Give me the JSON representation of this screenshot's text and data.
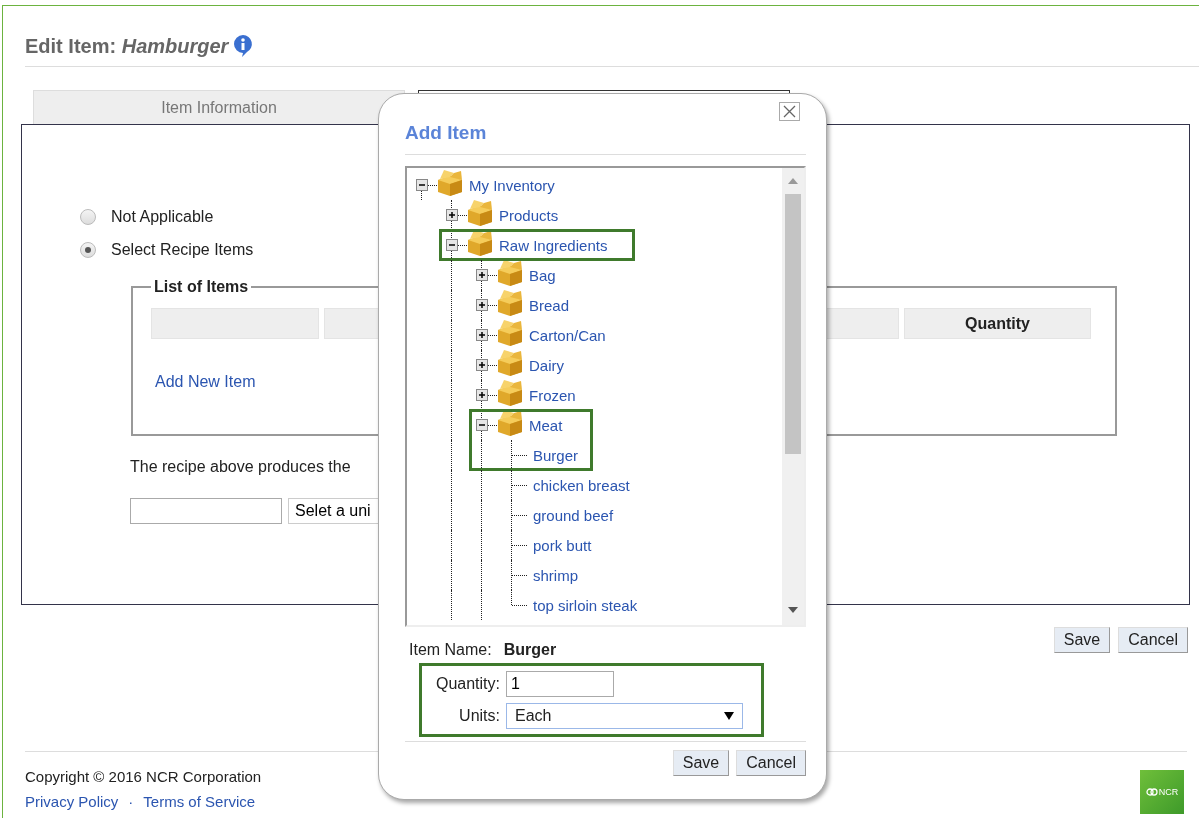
{
  "page": {
    "title_prefix": "Edit Item:",
    "title_item": "Hamburger"
  },
  "tabs": [
    {
      "label": "Item Information",
      "selected": false
    },
    {
      "selected": true
    }
  ],
  "recipe_options": [
    {
      "label": "Not Applicable",
      "selected": false
    },
    {
      "label": "Select Recipe Items",
      "selected": true
    }
  ],
  "list_of_items": {
    "legend": "List of Items",
    "columns": [
      "Quantity"
    ],
    "add_link": "Add New Item"
  },
  "yield": {
    "text": "The recipe above produces the",
    "unit_select": "Selet a uni"
  },
  "buttons": [
    "Save",
    "Cancel"
  ],
  "footer": {
    "copyright": "Copyright © 2016 NCR Corporation",
    "links": [
      "Privacy Policy",
      "Terms of Service"
    ],
    "separator": "·",
    "logo": "NCR"
  },
  "dialog": {
    "title": "Add Item",
    "tree": [
      {
        "label": "My Inventory",
        "kind": "folder",
        "expanded": true,
        "highlighted": false,
        "children": [
          {
            "label": "Products",
            "kind": "folder",
            "expanded": false,
            "highlighted": false
          },
          {
            "label": "Raw Ingredients",
            "kind": "folder",
            "expanded": true,
            "highlighted": true,
            "children": [
              {
                "label": "Bag",
                "kind": "folder",
                "expanded": false,
                "highlighted": false
              },
              {
                "label": "Bread",
                "kind": "folder",
                "expanded": false,
                "highlighted": false
              },
              {
                "label": "Carton/Can",
                "kind": "folder",
                "expanded": false,
                "highlighted": false
              },
              {
                "label": "Dairy",
                "kind": "folder",
                "expanded": false,
                "highlighted": false
              },
              {
                "label": "Frozen",
                "kind": "folder",
                "expanded": false,
                "highlighted": false
              },
              {
                "label": "Meat",
                "kind": "folder",
                "expanded": true,
                "highlighted": true,
                "children": [
                  {
                    "label": "Burger",
                    "kind": "item",
                    "highlighted": true
                  },
                  {
                    "label": "chicken breast",
                    "kind": "item",
                    "highlighted": false
                  },
                  {
                    "label": "ground beef",
                    "kind": "item",
                    "highlighted": false
                  },
                  {
                    "label": "pork butt",
                    "kind": "item",
                    "highlighted": false
                  },
                  {
                    "label": "shrimp",
                    "kind": "item",
                    "highlighted": false
                  },
                  {
                    "label": "top sirloin steak",
                    "kind": "item",
                    "highlighted": false
                  }
                ]
              }
            ]
          }
        ]
      }
    ],
    "item_name_label": "Item Name:",
    "item_name": "Burger",
    "quantity_label": "Quantity:",
    "quantity": "1",
    "units_label": "Units:",
    "units": "Each",
    "buttons": [
      "Save",
      "Cancel"
    ]
  }
}
